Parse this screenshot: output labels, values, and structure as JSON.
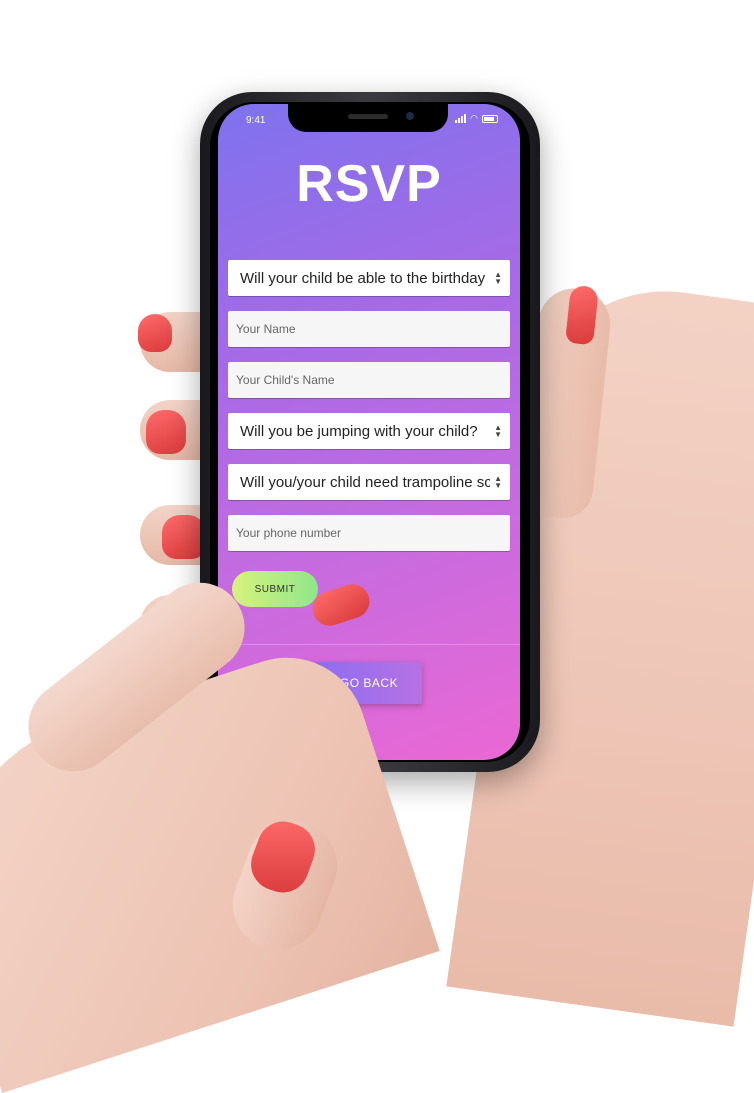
{
  "status_bar": {
    "time": "9:41"
  },
  "app": {
    "title": "RSVP"
  },
  "form": {
    "attendance_select": "Will your child be able to the birthday p",
    "name_placeholder": "Your Name",
    "child_name_placeholder": "Your Child's Name",
    "jumping_select": "Will you be jumping with your child?",
    "socks_select": "Will you/your child need trampoline sc",
    "phone_placeholder": "Your phone number",
    "submit_label": "SUBMIT"
  },
  "footer": {
    "go_back_label": "GO BACK"
  },
  "colors": {
    "gradient_top": "#7e72ee",
    "gradient_bottom": "#ea68d4",
    "submit_start": "#d7f27c",
    "submit_end": "#8fe68a",
    "nail": "#e04545"
  }
}
